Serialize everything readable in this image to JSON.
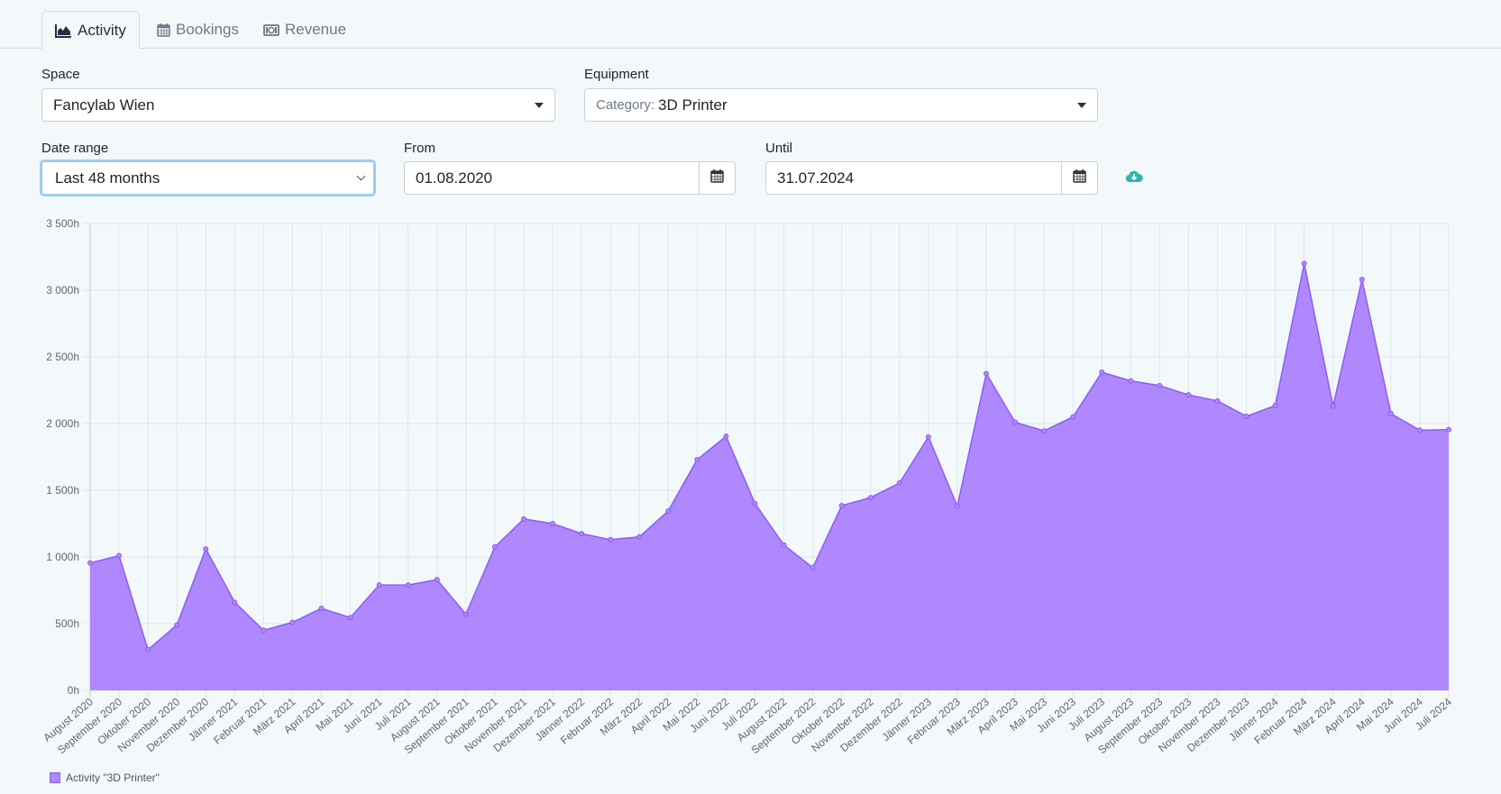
{
  "tabs": [
    {
      "label": "Activity",
      "icon": "area-chart-icon",
      "active": true
    },
    {
      "label": "Bookings",
      "icon": "calendar-icon",
      "active": false
    },
    {
      "label": "Revenue",
      "icon": "money-bill-icon",
      "active": false
    }
  ],
  "filters": {
    "space": {
      "label": "Space",
      "value": "Fancylab Wien"
    },
    "equipment": {
      "label": "Equipment",
      "prefix": "Category:",
      "value": "3D Printer"
    },
    "date_range": {
      "label": "Date range",
      "value": "Last 48 months"
    },
    "from": {
      "label": "From",
      "value": "01.08.2020"
    },
    "until": {
      "label": "Until",
      "value": "31.07.2024"
    },
    "download_icon": "cloud-download-icon"
  },
  "colors": {
    "accent": "#2fb5b0",
    "series_fill": "#b088fd",
    "series_line": "#8b5cf6"
  },
  "chart_data": {
    "type": "area",
    "title": "",
    "xlabel": "",
    "ylabel": "",
    "ylim": [
      0,
      3500
    ],
    "y_ticks": [
      "0h",
      "500h",
      "1 000h",
      "1 500h",
      "2 000h",
      "2 500h",
      "3 000h",
      "3 500h"
    ],
    "y_tick_values": [
      0,
      500,
      1000,
      1500,
      2000,
      2500,
      3000,
      3500
    ],
    "grid": true,
    "legend_position": "bottom-left",
    "categories": [
      "August 2020",
      "September 2020",
      "Oktober 2020",
      "November 2020",
      "Dezember 2020",
      "Jänner 2021",
      "Februar 2021",
      "März 2021",
      "April 2021",
      "Mai 2021",
      "Juni 2021",
      "Juli 2021",
      "August 2021",
      "September 2021",
      "Oktober 2021",
      "November 2021",
      "Dezember 2021",
      "Jänner 2022",
      "Februar 2022",
      "März 2022",
      "April 2022",
      "Mai 2022",
      "Juni 2022",
      "Juli 2022",
      "August 2022",
      "September 2022",
      "Oktober 2022",
      "November 2022",
      "Dezember 2022",
      "Jänner 2023",
      "Februar 2023",
      "März 2023",
      "April 2023",
      "Mai 2023",
      "Juni 2023",
      "Juli 2023",
      "August 2023",
      "September 2023",
      "Oktober 2023",
      "November 2023",
      "Dezember 2023",
      "Jänner 2024",
      "Februar 2024",
      "März 2024",
      "April 2024",
      "Mai 2024",
      "Juni 2024",
      "Juli 2024"
    ],
    "series": [
      {
        "name": "Activity \"3D Printer\"",
        "values": [
          955,
          1010,
          305,
          490,
          1060,
          660,
          450,
          510,
          615,
          545,
          790,
          790,
          830,
          570,
          1075,
          1285,
          1250,
          1175,
          1130,
          1150,
          1345,
          1730,
          1905,
          1400,
          1090,
          920,
          1385,
          1445,
          1555,
          1900,
          1380,
          2375,
          2010,
          1945,
          2050,
          2385,
          2320,
          2285,
          2215,
          2170,
          2055,
          2135,
          3200,
          2130,
          3080,
          2075,
          1950,
          1955
        ]
      }
    ]
  }
}
